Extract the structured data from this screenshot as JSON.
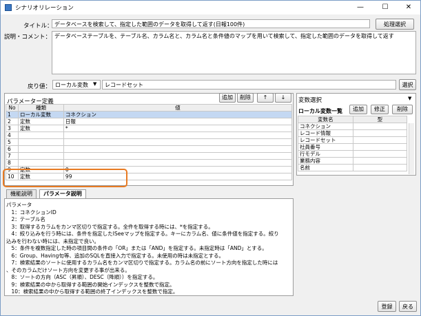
{
  "window": {
    "title": "シナリオリレーション",
    "min": "—",
    "max": "☐",
    "close": "✕"
  },
  "title_label": "タイトル：",
  "title_value": "データベースを検索して、指定した範囲のデータを取得して返す(日報100件)",
  "process_select_btn": "処理選択",
  "desc_label": "説明・コメント：",
  "desc_value": "データベーステーブルを、テーブル名、カラム名と、カラム名と条件値のマップを用いて検索して、指定した範囲のデータを取得して返す",
  "return_label": "戻り値：",
  "return_type": "ローカル変数",
  "return_value": "レコードセット",
  "select_btn": "選択",
  "params": {
    "header": "パラメーター定義",
    "add": "追加",
    "delete": "削除",
    "up": "↑",
    "down": "↓",
    "col_no": "No",
    "col_type": "種類",
    "col_value": "値",
    "rows": [
      {
        "no": "1",
        "type": "ローカル変数",
        "value": "コネクション"
      },
      {
        "no": "2",
        "type": "定数",
        "value": "日報"
      },
      {
        "no": "3",
        "type": "定数",
        "value": "*"
      },
      {
        "no": "4",
        "type": "",
        "value": ""
      },
      {
        "no": "5",
        "type": "",
        "value": ""
      },
      {
        "no": "6",
        "type": "",
        "value": ""
      },
      {
        "no": "7",
        "type": "",
        "value": ""
      },
      {
        "no": "8",
        "type": "",
        "value": ""
      },
      {
        "no": "9",
        "type": "定数",
        "value": "0"
      },
      {
        "no": "10",
        "type": "定数",
        "value": "99"
      }
    ]
  },
  "vars": {
    "header": "変数選択",
    "list_label": "ローカル変数一覧",
    "add": "追加",
    "edit": "修正",
    "delete": "削除",
    "col_name": "変数名",
    "col_type": "型",
    "rows": [
      "コネクション",
      "レコード情報",
      "レコードセット",
      "社員番号",
      "行モデル",
      "業務内容",
      "名前"
    ]
  },
  "tabs": {
    "func_desc": "機能説明",
    "param_desc": "パラメータ説明"
  },
  "param_desc_lines": [
    "パラメータ",
    "　1：コネクションID",
    "　2：テーブル名",
    "　3：取得するカラムをカンマ区切りで指定する。全件を取得する時には、*を指定する。",
    "　4：絞り込みを行う時には、条件を指定したISeeマップを指定する。キーにカラム名、値に条件値を指定する。絞り",
    "込みを行わない時には、未指定で良い。",
    "　5：条件を複数指定した時の項目間の条件の「OR」または「AND」を指定する。未指定時は「AND」とする。",
    "　6：Group、Having句等、追加のSQLを直接入力で指定する。未使用の時は未指定とする。",
    "　7：検索結果のソートに使用するカラム名をカンマ区切りで指定する。カラム名の前にソート方向を指定した時には",
    "、そのカラムだけソート方向を変更する事が出来る。",
    "　8：ソートの方向（ASC（昇順）、DESC（降順））を指定する。",
    "　9：検索結果の中から取得する範囲の開始インデックスを整数で指定。",
    "　10：検索結果の中から取得する範囲の終了インデックスを整数で指定。"
  ],
  "footer": {
    "register": "登録",
    "back": "戻る"
  }
}
